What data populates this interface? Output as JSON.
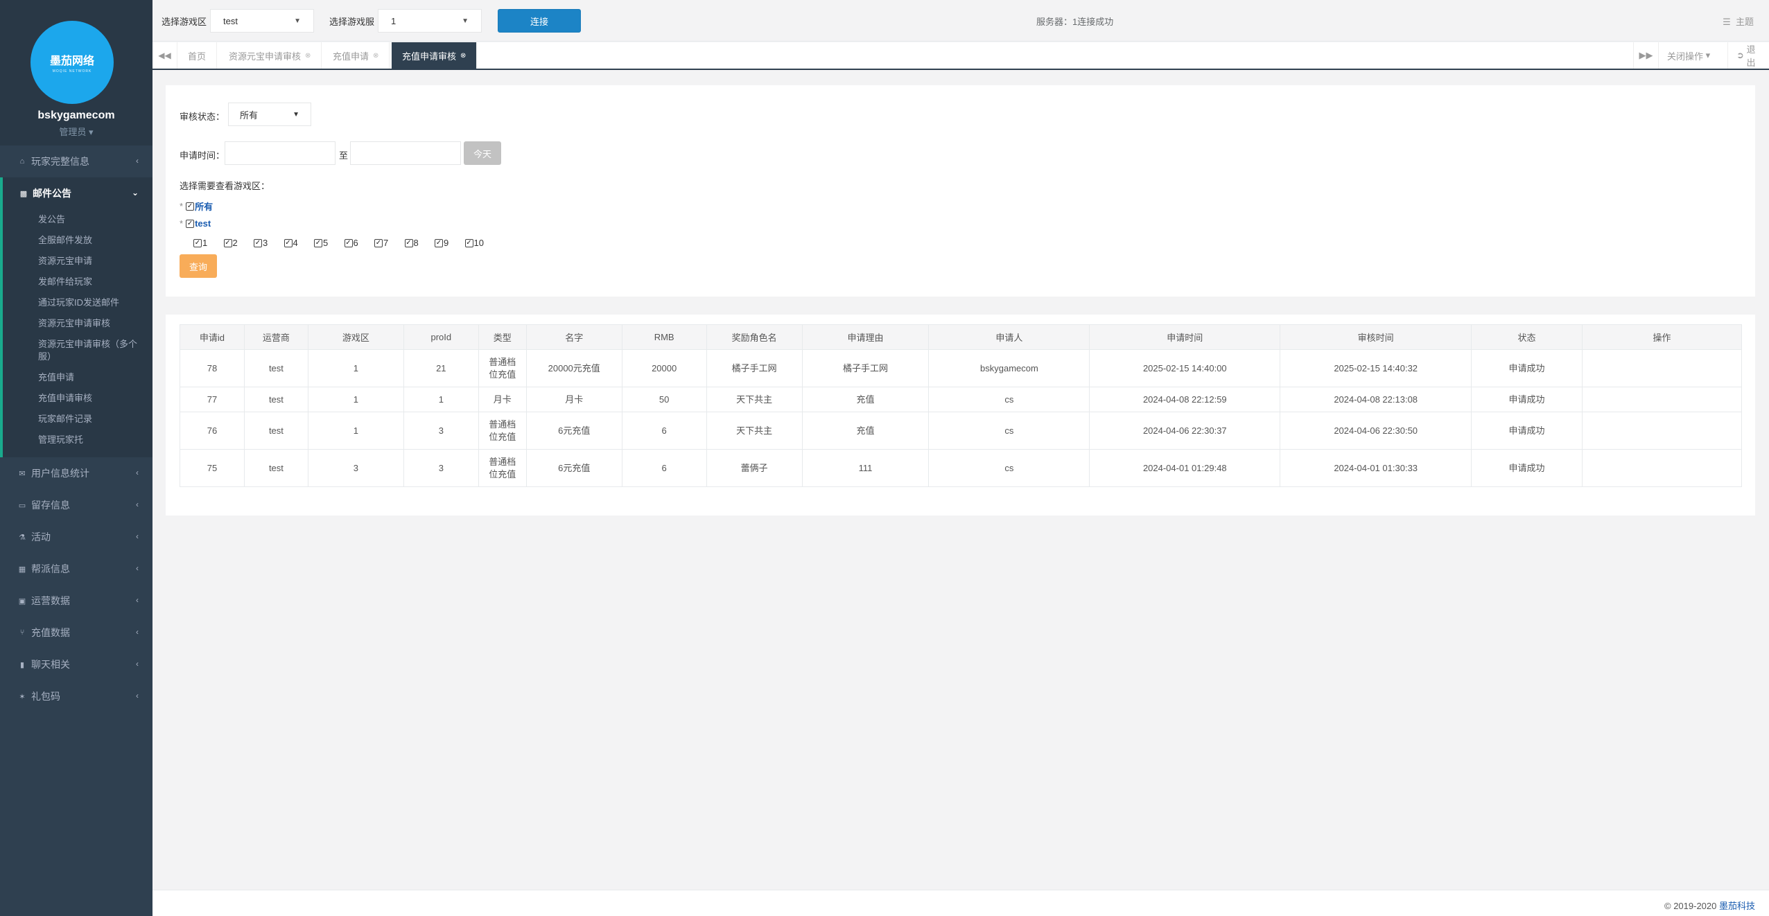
{
  "sidebar": {
    "logo_text": "墨茄网络",
    "logo_sub": "MOQIE NETWORK",
    "username": "bskygamecom",
    "role": "管理员 ▾",
    "top_items": [
      {
        "label": "玩家完整信息",
        "icon": "home-icon"
      }
    ],
    "active_group": {
      "label": "邮件公告",
      "icon": "bar-chart-icon",
      "items": [
        "发公告",
        "全服邮件发放",
        "资源元宝申请",
        "发邮件给玩家",
        "通过玩家ID发送邮件",
        "资源元宝申请审核",
        "资源元宝申请审核（多个服）",
        "充值申请",
        "充值申请审核",
        "玩家邮件记录",
        "管理玩家托"
      ]
    },
    "bottom_items": [
      {
        "label": "用户信息统计",
        "icon": "envelope-icon"
      },
      {
        "label": "留存信息",
        "icon": "desktop-icon"
      },
      {
        "label": "活动",
        "icon": "flask-icon"
      },
      {
        "label": "帮派信息",
        "icon": "table-icon"
      },
      {
        "label": "运营数据",
        "icon": "picture-icon"
      },
      {
        "label": "充值数据",
        "icon": "cutlery-icon"
      },
      {
        "label": "聊天相关",
        "icon": "book-icon"
      },
      {
        "label": "礼包码",
        "icon": "gift-icon"
      }
    ]
  },
  "topbar": {
    "zone_label": "选择游戏区",
    "zone_value": "test",
    "server_label": "选择游戏服",
    "server_value": "1",
    "connect_label": "连接",
    "server_status": "服务器：1连接成功",
    "theme_label": "主题"
  },
  "tabs": {
    "items": [
      {
        "label": "首页"
      },
      {
        "label": "资源元宝申请审核"
      },
      {
        "label": "充值申请"
      },
      {
        "label": "充值申请审核"
      }
    ],
    "close_ops": "关闭操作",
    "logout": "退出"
  },
  "filter": {
    "status_label": "审核状态：",
    "status_value": "所有",
    "time_label": "申请时间：",
    "to_label": "至",
    "today_label": "今天",
    "zone_prompt": "选择需要查看游戏区：",
    "all_label": "所有",
    "test_label": "test",
    "servers": [
      "1",
      "2",
      "3",
      "4",
      "5",
      "6",
      "7",
      "8",
      "9",
      "10"
    ],
    "query_label": "查询"
  },
  "table": {
    "columns": [
      "申请id",
      "运营商",
      "游戏区",
      "proId",
      "类型",
      "名字",
      "RMB",
      "奖励角色名",
      "申请理由",
      "申请人",
      "申请时间",
      "审核时间",
      "状态",
      "操作"
    ],
    "rows": [
      [
        "78",
        "test",
        "1",
        "21",
        "普通档位充值",
        "20000元充值",
        "20000",
        "橘子手工网",
        "橘子手工网",
        "bskygamecom",
        "2025-02-15 14:40:00",
        "2025-02-15 14:40:32",
        "申请成功",
        ""
      ],
      [
        "77",
        "test",
        "1",
        "1",
        "月卡",
        "月卡",
        "50",
        "天下共主",
        "充值",
        "cs",
        "2024-04-08 22:12:59",
        "2024-04-08 22:13:08",
        "申请成功",
        ""
      ],
      [
        "76",
        "test",
        "1",
        "3",
        "普通档位充值",
        "6元充值",
        "6",
        "天下共主",
        "充值",
        "cs",
        "2024-04-06 22:30:37",
        "2024-04-06 22:30:50",
        "申请成功",
        ""
      ],
      [
        "75",
        "test",
        "3",
        "3",
        "普通档位充值",
        "6元充值",
        "6",
        "蕾俩子",
        "111",
        "cs",
        "2024-04-01 01:29:48",
        "2024-04-01 01:30:33",
        "申请成功",
        ""
      ]
    ]
  },
  "footer": {
    "copyright": "© 2019-2020 ",
    "brand": "墨茄科技"
  }
}
